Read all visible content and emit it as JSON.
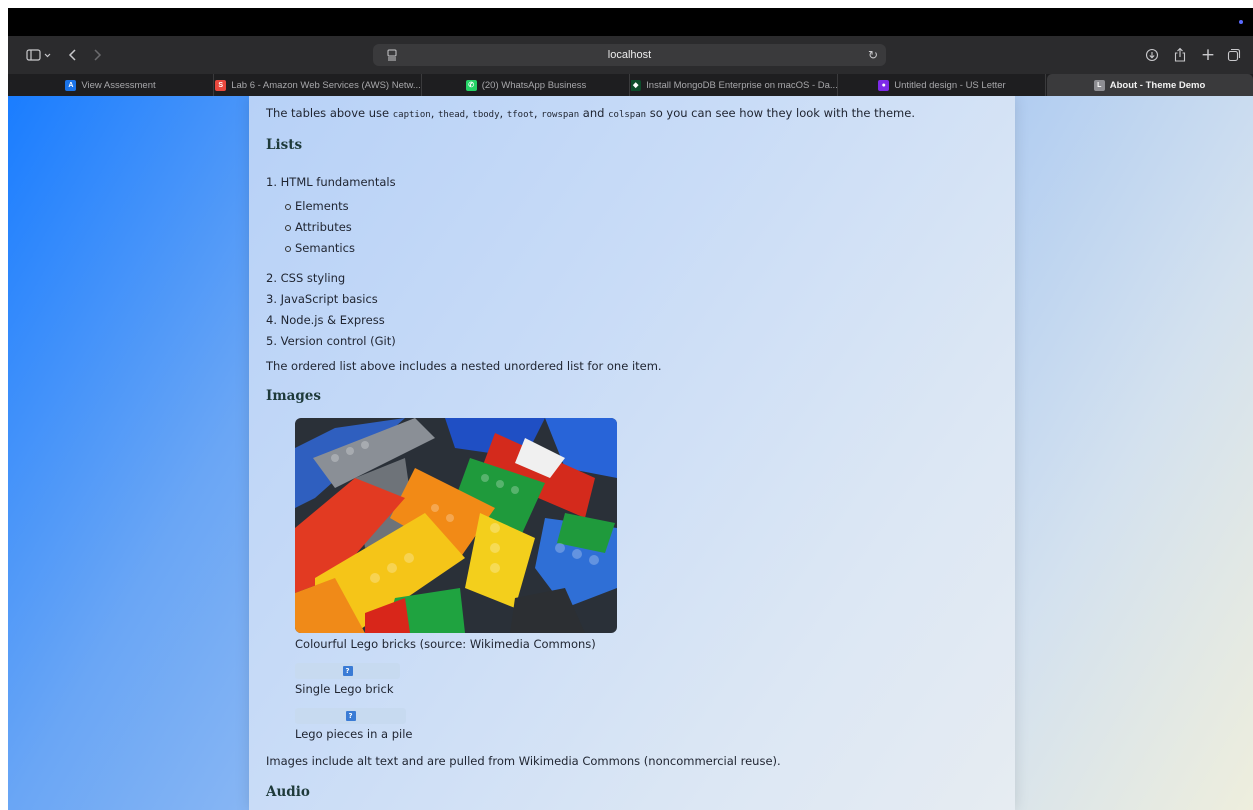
{
  "browser": {
    "url": "localhost",
    "tabs": [
      {
        "label": "View Assessment",
        "favicon_color": "#1a73e8",
        "favicon_glyph": "A"
      },
      {
        "label": "Lab 6 - Amazon Web Services (AWS) Netw...",
        "favicon_color": "#e8473d",
        "favicon_glyph": "S"
      },
      {
        "label": "(20) WhatsApp Business",
        "favicon_color": "#25d366",
        "favicon_glyph": "✆"
      },
      {
        "label": "Install MongoDB Enterprise on macOS - Da...",
        "favicon_color": "#0d4d2b",
        "favicon_glyph": "◆"
      },
      {
        "label": "Untitled design - US Letter",
        "favicon_color": "#7d2ae8",
        "favicon_glyph": "●"
      },
      {
        "label": "About - Theme Demo",
        "favicon_color": "#8e8e93",
        "favicon_glyph": "L"
      }
    ],
    "active_tab_index": 5,
    "icons": {
      "sidebar": "sidebar-icon",
      "back": "back-icon",
      "forward": "forward-icon",
      "page": "page-icon",
      "reload": "reload-icon",
      "downloads": "download-icon",
      "share": "share-icon",
      "new_tab": "plus-icon",
      "tab_overview": "tabs-icon"
    }
  },
  "page": {
    "intro": {
      "before": "The tables above use ",
      "codes": [
        "caption",
        "thead",
        "tbody",
        "tfoot",
        "rowspan",
        "colspan"
      ],
      "seps": [
        ", ",
        ", ",
        ", ",
        ", ",
        " and "
      ],
      "after": " so you can see how they look with the theme."
    },
    "lists": {
      "heading": "Lists",
      "items": [
        {
          "num": "1.",
          "text": "HTML fundamentals"
        },
        {
          "num": "2.",
          "text": "CSS styling"
        },
        {
          "num": "3.",
          "text": "JavaScript basics"
        },
        {
          "num": "4.",
          "text": "Node.js & Express"
        },
        {
          "num": "5.",
          "text": "Version control (Git)"
        }
      ],
      "nested": [
        "Elements",
        "Attributes",
        "Semantics"
      ],
      "note": "The ordered list above includes a nested unordered list for one item."
    },
    "images": {
      "heading": "Images",
      "captions": [
        "Colourful Lego bricks (source: Wikimedia Commons)",
        "Single Lego brick",
        "Lego pieces in a pile"
      ],
      "note": "Images include alt text and are pulled from Wikimedia Commons (noncommercial reuse)."
    },
    "audio": {
      "heading": "Audio"
    }
  }
}
